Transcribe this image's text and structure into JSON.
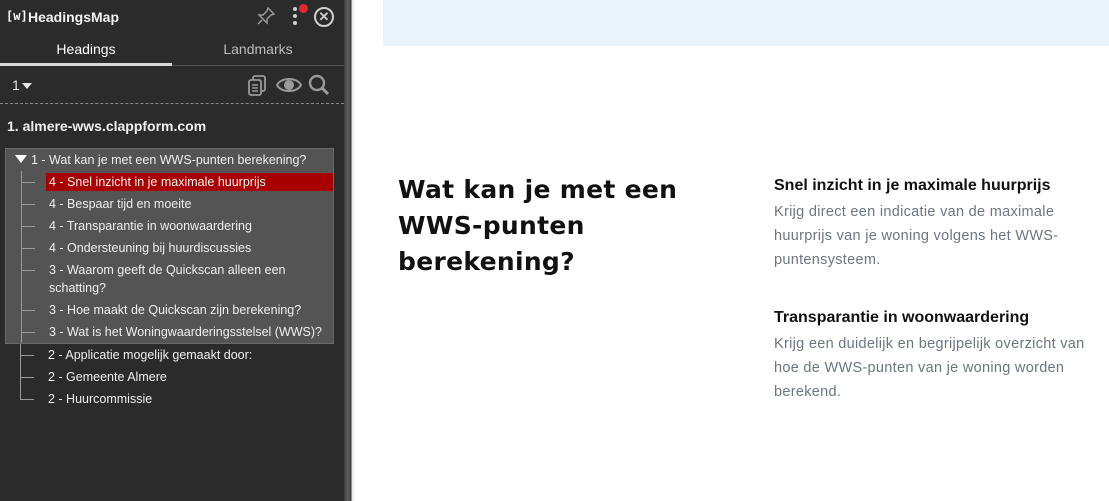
{
  "extension": {
    "logo": "[w]",
    "title": "HeadingsMap",
    "tabs": [
      "Headings",
      "Landmarks"
    ],
    "level_select": "1",
    "icons": [
      "pin-icon",
      "menu-icon",
      "close-icon",
      "copy-icon",
      "eye-icon",
      "search-icon"
    ],
    "accent_color": "#a80000",
    "domain": "1. almere-wws.clappform.com",
    "root_heading": "1 - Wat kan je met een WWS-punten berekening?",
    "children": [
      "4 - Snel inzicht in je maximale huurprijs",
      "4 - Bespaar tijd en moeite",
      "4 - Transparantie in woonwaardering",
      "4 - Ondersteuning bij huurdiscussies",
      "3 - Waarom geeft de Quickscan alleen een schatting?",
      "3 - Hoe maakt de Quickscan zijn berekening?",
      "3 - Wat is het Woningwaarderingsstelsel (WWS)?"
    ],
    "outside": [
      "2 - Applicatie mogelijk gemaakt door:",
      "2 - Gemeente Almere",
      "2 - Huurcommissie"
    ]
  },
  "page": {
    "heading": "Wat kan je met een WWS-punten berekening?",
    "features": [
      {
        "title": "Snel inzicht in je maximale huurprijs",
        "text": "Krijg direct een indicatie van de maximale huurprijs van je woning volgens het WWS-puntensysteem."
      },
      {
        "title": "Transparantie in woonwaardering",
        "text": "Krijg een duidelijk en begrijpelijk overzicht van hoe de WWS-punten van je woning worden berekend."
      }
    ]
  }
}
